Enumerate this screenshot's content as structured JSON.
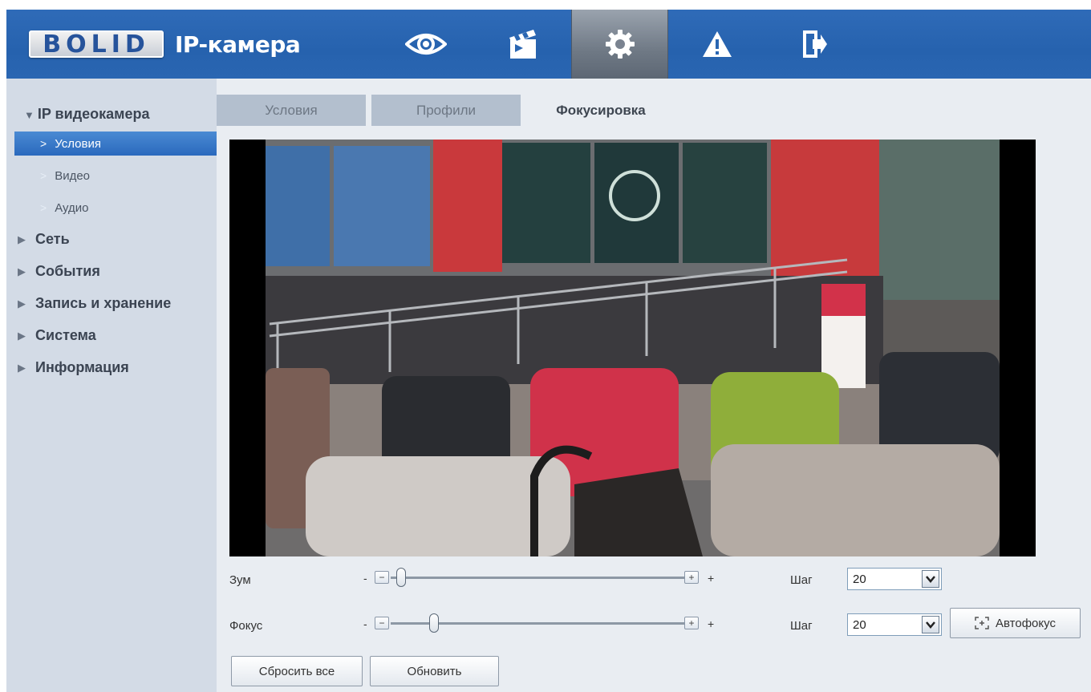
{
  "header": {
    "logo_text": "BOLID",
    "app_title": "IP-камера",
    "nav": [
      {
        "icon": "eye-icon",
        "name": "live-view"
      },
      {
        "icon": "clapperboard-icon",
        "name": "playback"
      },
      {
        "icon": "gear-icon",
        "name": "settings",
        "active": true
      },
      {
        "icon": "warning-icon",
        "name": "alarm"
      },
      {
        "icon": "logout-icon",
        "name": "logout"
      }
    ]
  },
  "sidebar": {
    "title": "IP видеокамера",
    "sub_items": [
      {
        "label": "Условия",
        "active": true
      },
      {
        "label": "Видео"
      },
      {
        "label": "Аудио"
      }
    ],
    "groups": [
      "Сеть",
      "События",
      "Запись и хранение",
      "Система",
      "Информация"
    ]
  },
  "tabs": [
    {
      "label": "Условия"
    },
    {
      "label": "Профили"
    },
    {
      "label": "Фокусировка",
      "active": true
    }
  ],
  "controls": {
    "zoom": {
      "label": "Зум",
      "minus": "-",
      "plus": "+",
      "value_fraction": 0.0,
      "step_label": "Шаг",
      "step_value": "20"
    },
    "focus": {
      "label": "Фокус",
      "minus": "-",
      "plus": "+",
      "value_fraction": 0.12,
      "step_label": "Шаг",
      "step_value": "20",
      "autofocus_label": "Автофокус"
    }
  },
  "buttons": {
    "reset": "Сбросить все",
    "refresh": "Обновить"
  },
  "colors": {
    "header_blue": "#2a66b2",
    "active_sidebar": "#2a69bd",
    "sidebar_bg": "#d3dbe6",
    "content_bg": "#e9edf2"
  }
}
